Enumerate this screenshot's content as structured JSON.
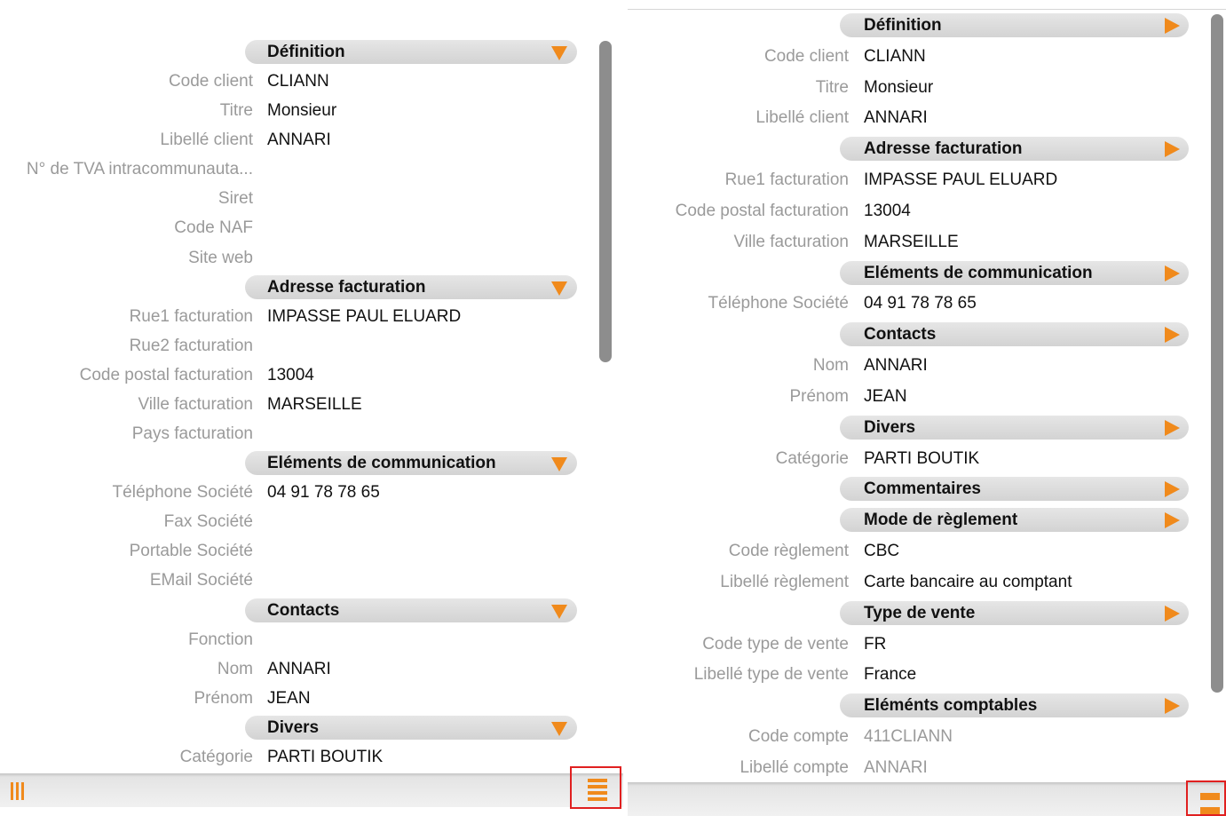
{
  "colors": {
    "accent": "#f08a1c",
    "highlight": "#e02020",
    "label": "#9a9a9a",
    "section_bg": "#dcdcdc"
  },
  "left": {
    "rows": [
      {
        "type": "section",
        "title": "Définition"
      },
      {
        "type": "field",
        "label": "Code client",
        "value": "CLIANN"
      },
      {
        "type": "field",
        "label": "Titre",
        "value": "Monsieur"
      },
      {
        "type": "field",
        "label": "Libellé client",
        "value": "ANNARI"
      },
      {
        "type": "field",
        "label": "N° de TVA intracommunauta...",
        "value": ""
      },
      {
        "type": "field",
        "label": "Siret",
        "value": ""
      },
      {
        "type": "field",
        "label": "Code NAF",
        "value": ""
      },
      {
        "type": "field",
        "label": "Site web",
        "value": ""
      },
      {
        "type": "section",
        "title": "Adresse facturation"
      },
      {
        "type": "field",
        "label": "Rue1 facturation",
        "value": "IMPASSE PAUL ELUARD"
      },
      {
        "type": "field",
        "label": "Rue2 facturation",
        "value": ""
      },
      {
        "type": "field",
        "label": "Code postal facturation",
        "value": "13004"
      },
      {
        "type": "field",
        "label": "Ville facturation",
        "value": "MARSEILLE"
      },
      {
        "type": "field",
        "label": "Pays facturation",
        "value": ""
      },
      {
        "type": "section",
        "title": "Eléments de communication"
      },
      {
        "type": "field",
        "label": "Téléphone Société",
        "value": "04 91 78 78 65"
      },
      {
        "type": "field",
        "label": "Fax Société",
        "value": ""
      },
      {
        "type": "field",
        "label": "Portable Société",
        "value": ""
      },
      {
        "type": "field",
        "label": "EMail Société",
        "value": ""
      },
      {
        "type": "section",
        "title": "Contacts"
      },
      {
        "type": "field",
        "label": "Fonction",
        "value": ""
      },
      {
        "type": "field",
        "label": "Nom",
        "value": "ANNARI"
      },
      {
        "type": "field",
        "label": "Prénom",
        "value": "JEAN"
      },
      {
        "type": "section",
        "title": "Divers"
      },
      {
        "type": "field",
        "label": "Catégorie",
        "value": "PARTI BOUTIK"
      }
    ],
    "bottom_left_icon": "columns-icon",
    "bottom_right_icon": "list-view-icon"
  },
  "right": {
    "rows": [
      {
        "type": "section",
        "title": "Définition"
      },
      {
        "type": "field",
        "label": "Code client",
        "value": "CLIANN"
      },
      {
        "type": "field",
        "label": "Titre",
        "value": "Monsieur"
      },
      {
        "type": "field",
        "label": "Libellé client",
        "value": "ANNARI"
      },
      {
        "type": "section",
        "title": "Adresse facturation"
      },
      {
        "type": "field",
        "label": "Rue1 facturation",
        "value": "IMPASSE PAUL ELUARD"
      },
      {
        "type": "field",
        "label": "Code postal facturation",
        "value": "13004"
      },
      {
        "type": "field",
        "label": "Ville facturation",
        "value": "MARSEILLE"
      },
      {
        "type": "section",
        "title": "Eléments de communication"
      },
      {
        "type": "field",
        "label": "Téléphone Société",
        "value": "04 91 78 78 65"
      },
      {
        "type": "section",
        "title": "Contacts"
      },
      {
        "type": "field",
        "label": "Nom",
        "value": "ANNARI"
      },
      {
        "type": "field",
        "label": "Prénom",
        "value": "JEAN"
      },
      {
        "type": "section",
        "title": "Divers"
      },
      {
        "type": "field",
        "label": "Catégorie",
        "value": "PARTI BOUTIK"
      },
      {
        "type": "section",
        "title": "Commentaires"
      },
      {
        "type": "section",
        "title": "Mode de règlement"
      },
      {
        "type": "field",
        "label": "Code règlement",
        "value": "CBC"
      },
      {
        "type": "field",
        "label": "Libellé règlement",
        "value": "Carte bancaire au comptant"
      },
      {
        "type": "section",
        "title": "Type de vente"
      },
      {
        "type": "field",
        "label": "Code type de vente",
        "value": "FR"
      },
      {
        "type": "field",
        "label": "Libellé type de vente",
        "value": "France"
      },
      {
        "type": "section",
        "title": "Eléménts comptables"
      },
      {
        "type": "field",
        "label": "Code compte",
        "value": "411CLIANN",
        "muted": true
      },
      {
        "type": "field",
        "label": "Libellé compte",
        "value": "ANNARI",
        "muted": true
      }
    ],
    "bottom_right_icon": "compact-view-icon"
  }
}
